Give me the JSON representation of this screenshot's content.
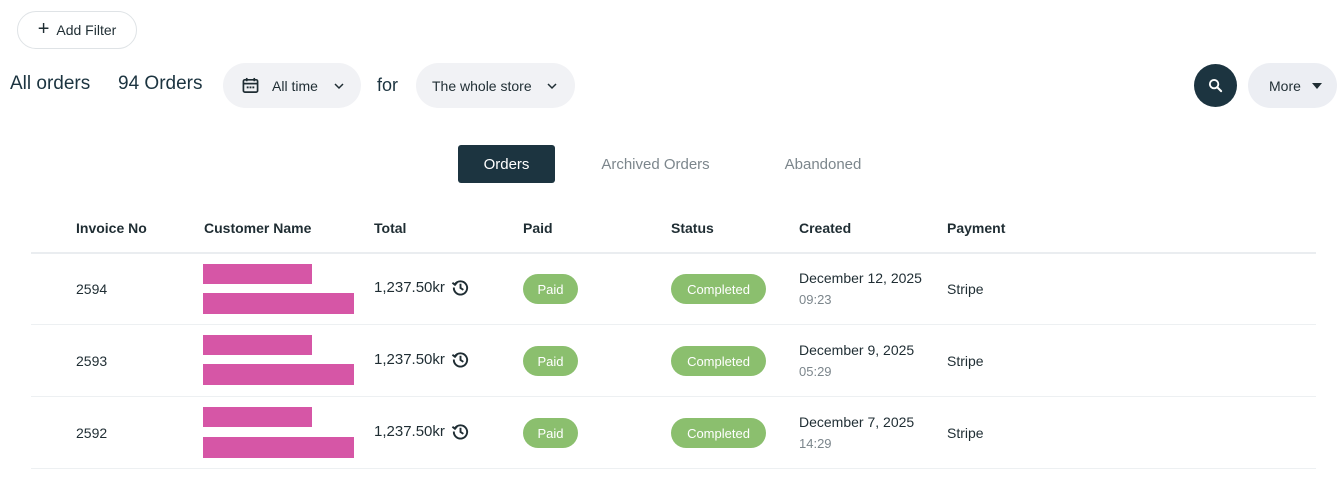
{
  "filter": {
    "add_label": "Add Filter"
  },
  "header": {
    "title": "All orders",
    "count": "94 Orders",
    "time_filter": "All time",
    "for_label": "for",
    "store_filter": "The whole store",
    "more_label": "More"
  },
  "tabs": [
    "Orders",
    "Archived Orders",
    "Abandoned"
  ],
  "active_tab": "Orders",
  "table": {
    "columns": [
      "Invoice No",
      "Customer Name",
      "Total",
      "Paid",
      "Status",
      "Created",
      "Payment"
    ],
    "rows": [
      {
        "invoice": "2594",
        "total": "1,237.50kr",
        "paid": "Paid",
        "status": "Completed",
        "date": "December 12, 2025",
        "time": "09:23",
        "payment": "Stripe"
      },
      {
        "invoice": "2593",
        "total": "1,237.50kr",
        "paid": "Paid",
        "status": "Completed",
        "date": "December 9, 2025",
        "time": "05:29",
        "payment": "Stripe"
      },
      {
        "invoice": "2592",
        "total": "1,237.50kr",
        "paid": "Paid",
        "status": "Completed",
        "date": "December 7, 2025",
        "time": "14:29",
        "payment": "Stripe"
      }
    ]
  },
  "colors": {
    "primary": "#1c3440",
    "badge": "#8bbf6e",
    "redaction": "#d656a6",
    "pill_bg": "#f1f2f5"
  },
  "icons": {
    "add": "plus-icon",
    "calendar": "calendar-icon",
    "dropdown": "chevron-down-icon",
    "search": "search-icon",
    "history": "history-icon"
  }
}
